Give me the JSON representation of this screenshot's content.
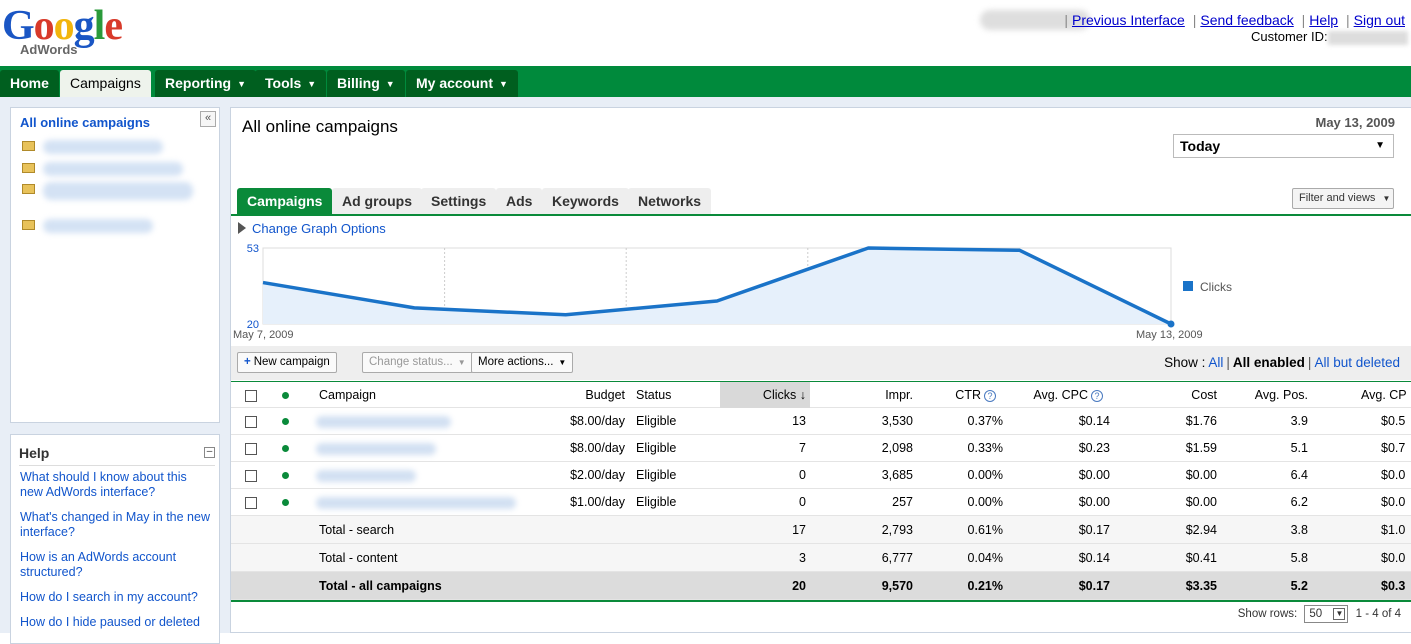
{
  "header": {
    "logo_main": "Google",
    "logo_sub": "AdWords",
    "links": [
      "Previous Interface",
      "Send feedback",
      "Help",
      "Sign out"
    ],
    "customer_label": "Customer ID:"
  },
  "nav": {
    "tabs": [
      {
        "label": "Home",
        "dropdown": false
      },
      {
        "label": "Campaigns",
        "dropdown": false
      },
      {
        "label": "Reporting",
        "dropdown": true
      },
      {
        "label": "Tools",
        "dropdown": true
      },
      {
        "label": "Billing",
        "dropdown": true
      },
      {
        "label": "My account",
        "dropdown": true
      }
    ],
    "active": "Campaigns"
  },
  "sidebar": {
    "title": "All online campaigns",
    "collapse_glyph": "«"
  },
  "help": {
    "title": "Help",
    "links": [
      "What should I know about this new AdWords interface?",
      "What's changed in May in the new interface?",
      "How is an AdWords account structured?",
      "How do I search in my account?",
      "How do I hide paused or deleted"
    ]
  },
  "main": {
    "title": "All online campaigns",
    "date": "May 13, 2009",
    "date_range": "Today",
    "tabs": [
      "Campaigns",
      "Ad groups",
      "Settings",
      "Ads",
      "Keywords",
      "Networks"
    ],
    "filter_button": "Filter and views",
    "graph_options": "Change Graph Options"
  },
  "chart_data": {
    "type": "line",
    "series": [
      {
        "name": "Clicks",
        "values": [
          38,
          27,
          24,
          30,
          53,
          52,
          20
        ]
      }
    ],
    "x": [
      "May 7, 2009",
      "May 8, 2009",
      "May 9, 2009",
      "May 10, 2009",
      "May 11, 2009",
      "May 12, 2009",
      "May 13, 2009"
    ],
    "x_tick_labels": [
      "May 7, 2009",
      "May 13, 2009"
    ],
    "y_tick_labels": [
      "53",
      "20"
    ],
    "ylim": [
      20,
      53
    ],
    "legend": "right",
    "color": "#1a73c8",
    "fill": "#e6f0fb"
  },
  "toolbar": {
    "new_campaign": "New campaign",
    "change_status": "Change status...",
    "more_actions": "More actions...",
    "show_label": "Show :",
    "show_all": "All",
    "show_enabled": "All enabled",
    "show_not_deleted": "All but deleted"
  },
  "table": {
    "columns": [
      "Campaign",
      "Budget",
      "Status",
      "Clicks",
      "Impr.",
      "CTR",
      "Avg. CPC",
      "Cost",
      "Avg. Pos.",
      "Avg. CP"
    ],
    "rows": [
      {
        "budget": "$8.00/day",
        "status": "Eligible",
        "clicks": "13",
        "impr": "3,530",
        "ctr": "0.37%",
        "cpc": "$0.14",
        "cost": "$1.76",
        "pos": "3.9",
        "cpm": "$0.5"
      },
      {
        "budget": "$8.00/day",
        "status": "Eligible",
        "clicks": "7",
        "impr": "2,098",
        "ctr": "0.33%",
        "cpc": "$0.23",
        "cost": "$1.59",
        "pos": "5.1",
        "cpm": "$0.7"
      },
      {
        "budget": "$2.00/day",
        "status": "Eligible",
        "clicks": "0",
        "impr": "3,685",
        "ctr": "0.00%",
        "cpc": "$0.00",
        "cost": "$0.00",
        "pos": "6.4",
        "cpm": "$0.0"
      },
      {
        "budget": "$1.00/day",
        "status": "Eligible",
        "clicks": "0",
        "impr": "257",
        "ctr": "0.00%",
        "cpc": "$0.00",
        "cost": "$0.00",
        "pos": "6.2",
        "cpm": "$0.0"
      }
    ],
    "totals": [
      {
        "label": "Total - search",
        "clicks": "17",
        "impr": "2,793",
        "ctr": "0.61%",
        "cpc": "$0.17",
        "cost": "$2.94",
        "pos": "3.8",
        "cpm": "$1.0"
      },
      {
        "label": "Total - content",
        "clicks": "3",
        "impr": "6,777",
        "ctr": "0.04%",
        "cpc": "$0.14",
        "cost": "$0.41",
        "pos": "5.8",
        "cpm": "$0.0"
      },
      {
        "label": "Total - all campaigns",
        "clicks": "20",
        "impr": "9,570",
        "ctr": "0.21%",
        "cpc": "$0.17",
        "cost": "$3.35",
        "pos": "5.2",
        "cpm": "$0.3"
      }
    ]
  },
  "footer": {
    "show_rows_label": "Show rows:",
    "rows_value": "50",
    "range": "1 - 4 of 4"
  }
}
